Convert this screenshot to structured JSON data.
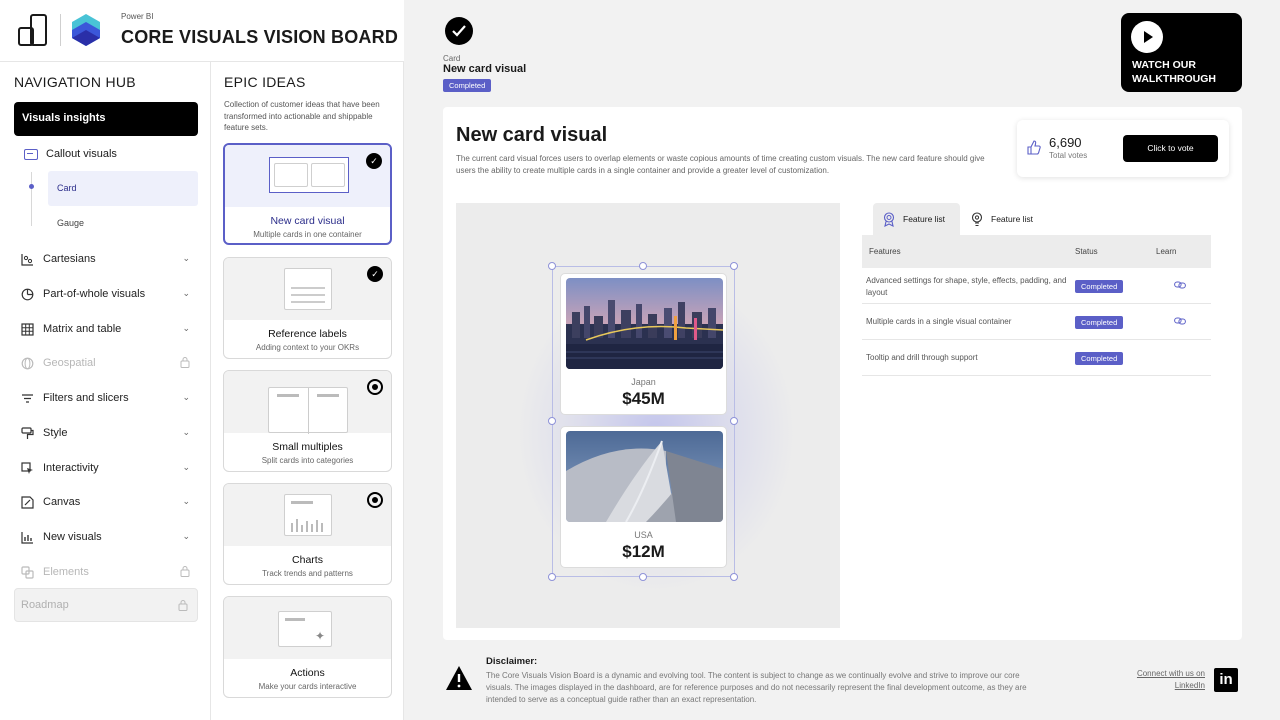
{
  "header": {
    "app_name": "Power BI",
    "board_title": "CORE VISUALS VISION BOARD"
  },
  "nav": {
    "title": "NAVIGATION HUB",
    "active_item": "Visuals insights",
    "callout_label": "Callout visuals",
    "sub_items": [
      "Card",
      "Gauge"
    ],
    "items": [
      {
        "label": "Cartesians",
        "icon": "scatter-chart-icon",
        "state": "expandable"
      },
      {
        "label": "Part-of-whole visuals",
        "icon": "pie-chart-icon",
        "state": "expandable"
      },
      {
        "label": "Matrix and table",
        "icon": "table-icon",
        "state": "expandable"
      },
      {
        "label": "Geospatial",
        "icon": "globe-icon",
        "state": "locked"
      },
      {
        "label": "Filters and slicers",
        "icon": "filter-icon",
        "state": "expandable"
      },
      {
        "label": "Style",
        "icon": "paint-icon",
        "state": "expandable"
      },
      {
        "label": "Interactivity",
        "icon": "cursor-icon",
        "state": "expandable"
      },
      {
        "label": "Canvas",
        "icon": "canvas-icon",
        "state": "expandable"
      },
      {
        "label": "New visuals",
        "icon": "chart-sparkle-icon",
        "state": "expandable"
      },
      {
        "label": "Elements",
        "icon": "elements-icon",
        "state": "locked"
      }
    ],
    "roadmap_label": "Roadmap"
  },
  "epic": {
    "title": "EPIC IDEAS",
    "description": "Collection of customer ideas that have been transformed into actionable and shippable feature sets.",
    "ideas": [
      {
        "name": "New card visual",
        "sub": "Multiple cards in one container",
        "status": "done"
      },
      {
        "name": "Reference labels",
        "sub": "Adding context to your OKRs",
        "status": "done"
      },
      {
        "name": "Small multiples",
        "sub": "Split cards into categories",
        "status": "in-progress"
      },
      {
        "name": "Charts",
        "sub": "Track trends and patterns",
        "status": "in-progress"
      },
      {
        "name": "Actions",
        "sub": "Make your cards interactive",
        "status": "none"
      }
    ]
  },
  "main": {
    "crumb_label": "Card",
    "crumb_title": "New card visual",
    "crumb_status": "Completed",
    "watch_label": "WATCH OUR WALKTHROUGH",
    "panel": {
      "title": "New card visual",
      "description": "The current card visual forces users to overlap elements or waste copious amounts of time creating custom visuals. The new card feature should give users the ability to create multiple cards in a single container and provide a greater level of customization.",
      "votes_count": "6,690",
      "votes_label": "Total votes",
      "vote_button": "Click to vote"
    },
    "cards": [
      {
        "country": "Japan",
        "amount": "$45M"
      },
      {
        "country": "USA",
        "amount": "$12M"
      }
    ],
    "tabs": [
      "Feature list",
      "Feature list"
    ],
    "table": {
      "headers": [
        "Features",
        "Status",
        "Learn"
      ],
      "rows": [
        {
          "feature": "Advanced settings for shape, style, effects, padding, and layout",
          "status": "Completed",
          "link": true
        },
        {
          "feature": "Multiple cards in a single visual container",
          "status": "Completed",
          "link": true
        },
        {
          "feature": "Tooltip and drill through support",
          "status": "Completed",
          "link": false
        }
      ]
    },
    "footer": {
      "disclaimer_title": "Disclaimer:",
      "disclaimer_text": "The Core Visuals Vision Board is a dynamic and evolving tool. The content is subject to change as we continually evolve and strive to improve our core visuals. The images displayed in the dashboard, are for reference purposes and do not necessarily represent the final development outcome, as they are intended to serve as a conceptual guide rather than an exact representation.",
      "connect_label": "Connect with us on LinkedIn",
      "linkedin_glyph": "in"
    }
  },
  "colors": {
    "accent": "#5b5fc7",
    "dark": "#000000",
    "panel_bg": "#f2f2f2"
  }
}
